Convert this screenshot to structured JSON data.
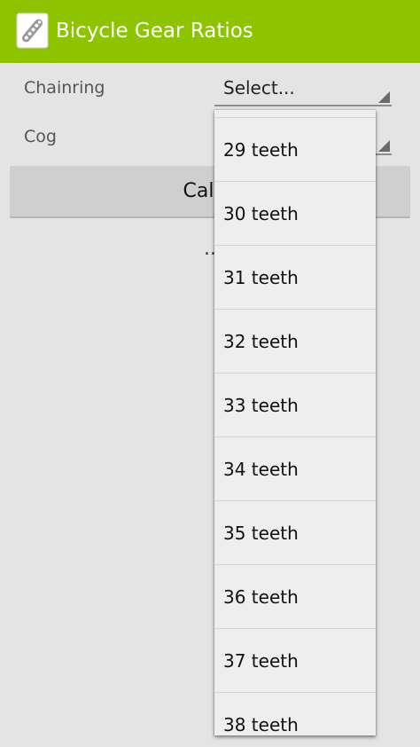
{
  "app": {
    "title": "Bicycle Gear Ratios",
    "icon": "bicycle-chain-icon"
  },
  "form": {
    "chainring_label": "Chainring",
    "chainring_value": "Select...",
    "cog_label": "Cog",
    "calculate_label": "Calcu",
    "result_text": ".."
  },
  "dropdown": {
    "items": [
      "29 teeth",
      "30 teeth",
      "31 teeth",
      "32 teeth",
      "33 teeth",
      "34 teeth",
      "35 teeth",
      "36 teeth",
      "37 teeth",
      "38 teeth"
    ]
  },
  "colors": {
    "app_bar": "#8ec300",
    "background": "#e4e4e4",
    "dropdown": "#eeeeee"
  }
}
